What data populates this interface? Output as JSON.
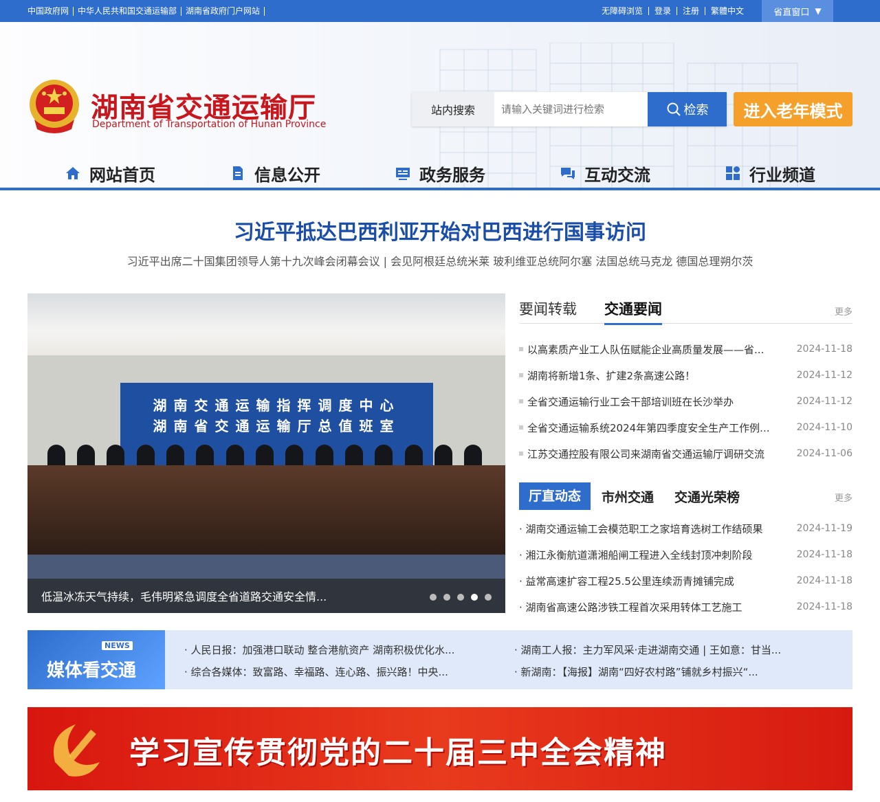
{
  "topbar": {
    "links": [
      "中国政府网",
      "中华人民共和国交通运输部",
      "湖南省政府门户网站"
    ],
    "right_links": [
      "无障碍浏览",
      "登录",
      "注册",
      "繁體中文"
    ],
    "window_label": "省直窗口"
  },
  "header": {
    "title": "湖南省交通运输厅",
    "subtitle": "Department of Transportation of Hunan Province",
    "search_label": "站内搜索",
    "search_placeholder": "请输入关键词进行检索",
    "search_button": "检索",
    "elder_mode": "进入老年模式"
  },
  "nav": [
    {
      "label": "网站首页",
      "icon": "home-icon"
    },
    {
      "label": "信息公开",
      "icon": "document-icon"
    },
    {
      "label": "政务服务",
      "icon": "service-icon"
    },
    {
      "label": "互动交流",
      "icon": "chat-icon"
    },
    {
      "label": "行业频道",
      "icon": "grid-icon"
    }
  ],
  "headline": {
    "title": "习近平抵达巴西利亚开始对巴西进行国事访问",
    "sub": "习近平出席二十国集团领导人第十九次峰会闭幕会议 | 会见阿根廷总统米莱 玻利维亚总统阿尔塞 法国总统马克龙 德国总理朔尔茨"
  },
  "slider": {
    "banner_line1": "湖南交通运输指挥调度中心",
    "banner_line2": "湖南省交通运输厅总值班室",
    "caption": "低温冰冻天气持续，毛伟明紧急调度全省道路交通安全情...",
    "dot_count": 5,
    "active_dot": 4
  },
  "news1": {
    "tabs": [
      "要闻转载",
      "交通要闻"
    ],
    "active_tab": 1,
    "more": "更多",
    "items": [
      {
        "title": "以高素质产业工人队伍赋能企业高质量发展——省...",
        "date": "2024-11-18"
      },
      {
        "title": "湖南将新增1条、扩建2条高速公路！",
        "date": "2024-11-12"
      },
      {
        "title": "全省交通运输行业工会干部培训班在长沙举办",
        "date": "2024-11-12"
      },
      {
        "title": "全省交通运输系统2024年第四季度安全生产工作例...",
        "date": "2024-11-10"
      },
      {
        "title": "江苏交通控股有限公司来湖南省交通运输厅调研交流",
        "date": "2024-11-06"
      }
    ]
  },
  "news2": {
    "tabs": [
      "厅直动态",
      "市州交通",
      "交通光荣榜"
    ],
    "active_tab": 0,
    "more": "更多",
    "items": [
      {
        "title": "· 湖南交通运输工会模范职工之家培育选树工作结硕果",
        "date": "2024-11-19"
      },
      {
        "title": "· 湘江永衡航道潇湘船闸工程进入全线封顶冲刺阶段",
        "date": "2024-11-18"
      },
      {
        "title": "· 益常高速扩容工程25.5公里连续沥青摊铺完成",
        "date": "2024-11-18"
      },
      {
        "title": "· 湖南省高速公路涉铁工程首次采用转体工艺施工",
        "date": "2024-11-18"
      }
    ]
  },
  "media": {
    "badge_tag": "NEWS",
    "badge_title": "媒体看交通",
    "items": [
      "· 人民日报：加强港口联动 整合港航资产 湖南积极优化水...",
      "· 湖南工人报：主力军风采·走进湖南交通 | 王如意：甘当...",
      "· 综合各媒体：致富路、幸福路、连心路、振兴路！中央...",
      "· 新湖南：【海报】湖南“四好农村路”铺就乡村振兴“..."
    ]
  },
  "party_banner": {
    "text": "学习宣传贯彻党的二十届三中全会精神"
  },
  "colors": {
    "primary": "#2e6dcc",
    "title_red": "#c8161d",
    "accent_orange": "#f4a02a"
  }
}
